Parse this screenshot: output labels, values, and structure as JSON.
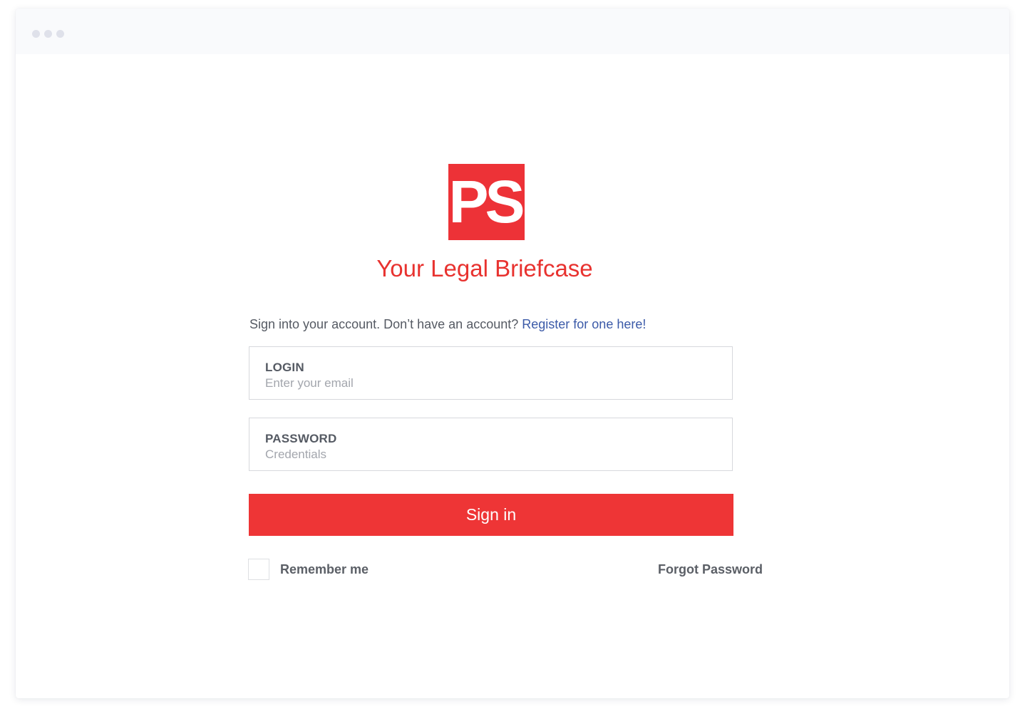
{
  "brand": {
    "logo_text": "PS",
    "tagline": "Your Legal Briefcase",
    "accent_color": "#ED3237"
  },
  "signin": {
    "prompt_text": "Sign into your account. Don’t have an account?",
    "register_link": "Register for one here!"
  },
  "form": {
    "login": {
      "label": "LOGIN",
      "value": "",
      "placeholder": "Enter your email"
    },
    "password": {
      "label": "PASSWORD",
      "value": "",
      "placeholder": "Credentials"
    },
    "submit_label": "Sign in",
    "remember_me": {
      "label": "Remember me",
      "checked": false
    },
    "forgot_password_label": "Forgot Password"
  }
}
